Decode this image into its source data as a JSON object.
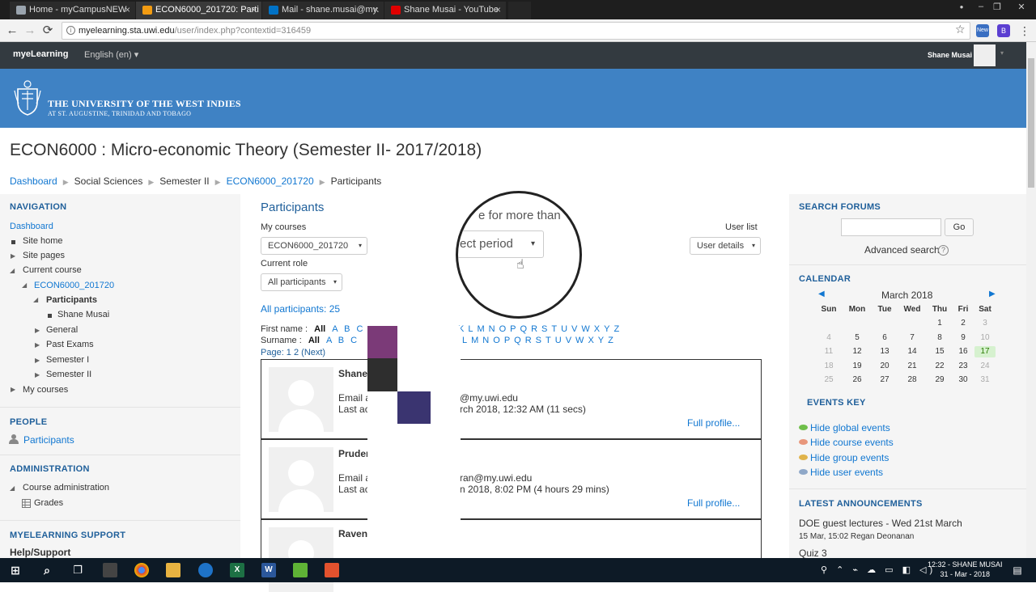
{
  "browser": {
    "tabs": [
      {
        "label": "Home - myCampusNEW",
        "fav_color": "#9aa4ae"
      },
      {
        "label": "ECON6000_201720: Parti",
        "fav_color": "#f39c12"
      },
      {
        "label": "Mail - shane.musai@my.",
        "fav_color": "#0072c6"
      },
      {
        "label": "Shane Musai - YouTube",
        "fav_color": "#e00000"
      }
    ],
    "tab_close": "×",
    "back_icon": "←",
    "forward_icon": "→",
    "reload_icon": "⟳",
    "info_icon": "i",
    "url_host": "myelearning.sta.uwi.edu",
    "url_path": "/user/index.php?contextid=316459",
    "star_icon": "☆",
    "menu_icon": "⋮",
    "ext_new": "New",
    "ext_b": "B",
    "minimize_icon": "‒",
    "restore_icon": "❐",
    "close_icon": "✕",
    "user_icon": "●"
  },
  "moodle_nav": {
    "brand": "myeLearning",
    "language": "English (en) ▾",
    "user": "Shane Musai",
    "caret": "▾"
  },
  "banner": {
    "name": "THE UNIVERSITY OF THE WEST INDIES",
    "sub": "AT ST. AUGUSTINE, TRINIDAD AND TOBAGO"
  },
  "page": {
    "course_title": "ECON6000 : Micro-economic Theory (Semester II- 2017/2018)",
    "breadcrumb": [
      "Dashboard",
      "Social Sciences",
      "Semester II",
      "ECON6000_201720",
      "Participants"
    ],
    "bc_sep": "▶"
  },
  "left": {
    "nav_title": "NAVIGATION",
    "dashboard": "Dashboard",
    "site_home": "Site home",
    "site_pages": "Site pages",
    "current_course": "Current course",
    "course_code": "ECON6000_201720",
    "participants": "Participants",
    "shane": "Shane Musai",
    "general": "General",
    "past_exams": "Past Exams",
    "sem1": "Semester I",
    "sem2": "Semester II",
    "my_courses": "My courses",
    "people_title": "PEOPLE",
    "people_participants": "Participants",
    "admin_title": "ADMINISTRATION",
    "course_admin": "Course administration",
    "grades": "Grades",
    "support_title": "MYELEARNING SUPPORT",
    "help": "Help/Support",
    "tri_right": "▶",
    "tri_down": "◢"
  },
  "main": {
    "heading": "Participants",
    "my_courses_label": "My courses",
    "my_courses_value": "ECON6000_201720",
    "user_list_label": "User list",
    "user_list_value": "User details",
    "role_label": "Current role",
    "role_value": "All participants",
    "count": "All participants: 25",
    "caret": "▾",
    "loupe_text": "e for more than",
    "loupe_select": "ect period",
    "cursor": "☝",
    "firstname_label": "First name :",
    "surname_label": "Surname :",
    "all": "All",
    "letters_pre": [
      "A",
      "B",
      "C"
    ],
    "first_letters_post": [
      "K",
      "L",
      "M",
      "N",
      "O",
      "P",
      "Q",
      "R",
      "S",
      "T",
      "U",
      "V",
      "W",
      "X",
      "Y",
      "Z"
    ],
    "sur_letters_post": [
      "L",
      "M",
      "N",
      "O",
      "P",
      "Q",
      "R",
      "S",
      "T",
      "U",
      "V",
      "W",
      "X",
      "Y",
      "Z"
    ],
    "paging": "Page: 1 2 (Next)",
    "users": [
      {
        "name": "Shane",
        "email_label": "Email a",
        "email_tail": "@my.uwi.edu",
        "access_label": "Last ac",
        "access_tail": "rch 2018, 12:32 AM  (11 secs)",
        "full": "Full profile..."
      },
      {
        "name": "Pruder",
        "email_label": "Email a",
        "email_tail": "ran@my.uwi.edu",
        "access_label": "Last ac",
        "access_tail": "n 2018, 8:02 PM  (4 hours 29 mins)",
        "full": "Full profile..."
      },
      {
        "name": "Raven",
        "email_label": "",
        "email_tail": "",
        "access_label": "",
        "access_tail": "",
        "full": ""
      }
    ]
  },
  "right": {
    "search_title": "SEARCH FORUMS",
    "go": "Go",
    "advanced": "Advanced search",
    "help_icon": "?",
    "calendar_title": "CALENDAR",
    "month": "March 2018",
    "prev": "◀",
    "next": "▶",
    "weekdays": [
      "Sun",
      "Mon",
      "Tue",
      "Wed",
      "Thu",
      "Fri",
      "Sat"
    ],
    "weeks": [
      [
        "",
        "",
        "",
        "",
        "1",
        "2",
        "3"
      ],
      [
        "4",
        "5",
        "6",
        "7",
        "8",
        "9",
        "10"
      ],
      [
        "11",
        "12",
        "13",
        "14",
        "15",
        "16",
        "17"
      ],
      [
        "18",
        "19",
        "20",
        "21",
        "22",
        "23",
        "24"
      ],
      [
        "25",
        "26",
        "27",
        "28",
        "29",
        "30",
        "31"
      ]
    ],
    "today": "17",
    "events_title": "EVENTS KEY",
    "events": [
      {
        "label": "Hide global events",
        "color": "#6fbf4a"
      },
      {
        "label": "Hide course events",
        "color": "#e8967a"
      },
      {
        "label": "Hide group events",
        "color": "#e0b34a"
      },
      {
        "label": "Hide user events",
        "color": "#8fa8c8"
      }
    ],
    "announcements_title": "LATEST ANNOUNCEMENTS",
    "ann1": "DOE guest lectures - Wed 21st March",
    "ann1_meta": "15 Mar, 15:02  Regan Deonanan",
    "ann2": "Quiz 3"
  },
  "taskbar": {
    "start_icon": "⊞",
    "search_icon": "⌕",
    "taskview_icon": "❐",
    "excel": "X",
    "word": "W",
    "time": "12:32 - SHANE MUSAI",
    "date": "31 - Mar - 2018",
    "tray_icons": "⚲  ⌃  ⌁  ☁  ▭  ◧  ◁)"
  },
  "colors": {
    "navbar": "#333a40",
    "banner": "#3f82c4",
    "link": "#1177d1",
    "block_title": "#1f5f9a",
    "redact_purple": "#7b3a78",
    "redact_dark": "#2e2e2e",
    "redact_navy": "#3a3470"
  }
}
